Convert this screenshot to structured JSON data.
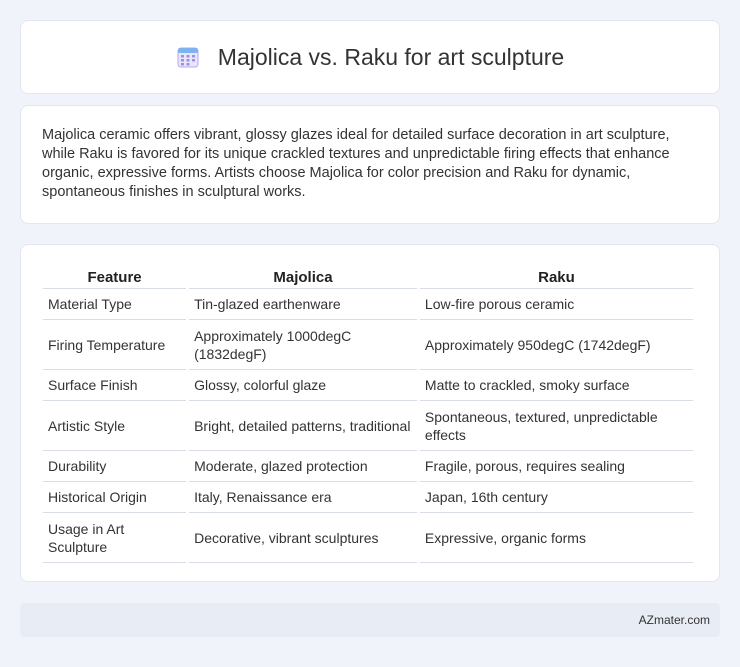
{
  "header": {
    "title": "Majolica vs. Raku for art sculpture",
    "icon": "calendar-icon"
  },
  "summary": {
    "text": "Majolica ceramic offers vibrant, glossy glazes ideal for detailed surface decoration in art sculpture, while Raku is favored for its unique crackled textures and unpredictable firing effects that enhance organic, expressive forms. Artists choose Majolica for color precision and Raku for dynamic, spontaneous finishes in sculptural works."
  },
  "table": {
    "headers": [
      "Feature",
      "Majolica",
      "Raku"
    ],
    "rows": [
      [
        "Material Type",
        "Tin-glazed earthenware",
        "Low-fire porous ceramic"
      ],
      [
        "Firing Temperature",
        "Approximately 1000degC (1832degF)",
        "Approximately 950degC (1742degF)"
      ],
      [
        "Surface Finish",
        "Glossy, colorful glaze",
        "Matte to crackled, smoky surface"
      ],
      [
        "Artistic Style",
        "Bright, detailed patterns, traditional",
        "Spontaneous, textured, unpredictable effects"
      ],
      [
        "Durability",
        "Moderate, glazed protection",
        "Fragile, porous, requires sealing"
      ],
      [
        "Historical Origin",
        "Italy, Renaissance era",
        "Japan, 16th century"
      ],
      [
        "Usage in Art Sculpture",
        "Decorative, vibrant sculptures",
        "Expressive, organic forms"
      ]
    ]
  },
  "footer": {
    "brand": "AZmater.com"
  },
  "colors": {
    "background": "#f0f3f9",
    "card": "#ffffff",
    "footer": "#e8ecf5",
    "icon_accent": "#7b6fd6"
  }
}
